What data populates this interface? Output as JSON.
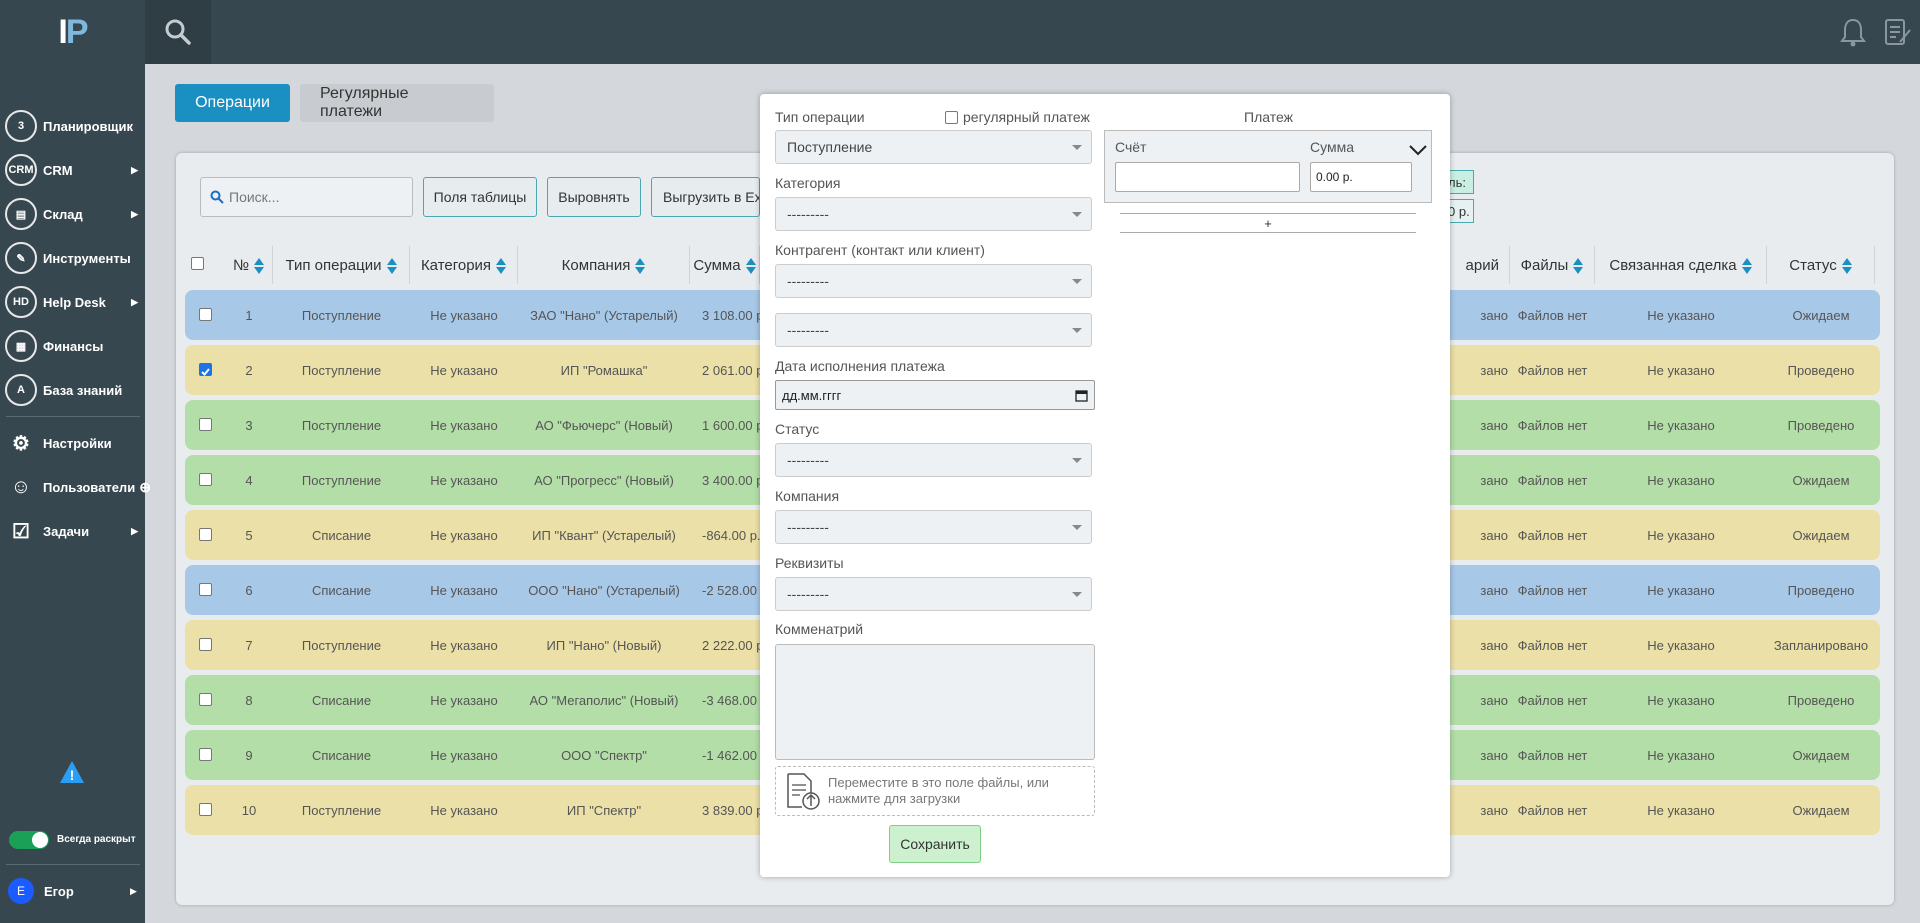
{
  "app": {
    "logo_a": "I",
    "logo_b": "P"
  },
  "sidebar": {
    "items": [
      {
        "label": "Планировщик",
        "icon": "calendar-icon",
        "glyph": "3",
        "arrow": false
      },
      {
        "label": "CRM",
        "icon": "crm-icon",
        "glyph": "CRM",
        "arrow": true
      },
      {
        "label": "Склад",
        "icon": "warehouse-icon",
        "glyph": "▤",
        "arrow": true
      },
      {
        "label": "Инструменты",
        "icon": "wrench-icon",
        "glyph": "✎",
        "arrow": false
      },
      {
        "label": "Help Desk",
        "icon": "helpdesk-icon",
        "glyph": "HD",
        "arrow": true
      },
      {
        "label": "Финансы",
        "icon": "finance-icon",
        "glyph": "▦",
        "arrow": false
      },
      {
        "label": "База знаний",
        "icon": "knowledge-icon",
        "glyph": "A",
        "arrow": false
      }
    ],
    "items2": [
      {
        "label": "Настройки",
        "icon": "gear-icon",
        "glyph": "⚙",
        "arrow": false
      },
      {
        "label": "Пользователи",
        "icon": "users-icon",
        "glyph": "☺",
        "arrow": false
      },
      {
        "label": "Задачи",
        "icon": "tasks-icon",
        "glyph": "☑",
        "arrow": true
      }
    ],
    "always_open_label": "Всегда раскрыт",
    "user_name": "Егор",
    "user_initial": "Е",
    "warning_glyph": "!"
  },
  "tabs": {
    "operations": "Операции",
    "regular": "Регулярные платежи"
  },
  "toolbar": {
    "search_placeholder": "Поиск...",
    "fields_label": "Поля таблицы",
    "align_label": "Выровнять",
    "export_label": "Выгрузить в Excel",
    "partial_top": "ль:",
    "partial_bottom": "0 р."
  },
  "table": {
    "headers": {
      "num": "№",
      "type": "Тип операции",
      "category": "Категория",
      "company": "Компания",
      "sum": "Сумма",
      "comment": "арий",
      "files": "Файлы",
      "deal": "Связанная сделка",
      "status": "Статус"
    },
    "rows": [
      {
        "num": "1",
        "type": "Поступление",
        "category": "Не указано",
        "company": "ЗАО \"Нано\" (Устарелый)",
        "sum": "3 108.00 р.",
        "comment": "зано",
        "files": "Файлов нет",
        "deal": "Не указано",
        "status": "Ожидаем",
        "color": "blue",
        "checked": false
      },
      {
        "num": "2",
        "type": "Поступление",
        "category": "Не указано",
        "company": "ИП \"Ромашка\"",
        "sum": "2 061.00 р.",
        "comment": "зано",
        "files": "Файлов нет",
        "deal": "Не указано",
        "status": "Проведено",
        "color": "yellow",
        "checked": true
      },
      {
        "num": "3",
        "type": "Поступление",
        "category": "Не указано",
        "company": "АО \"Фьючерс\" (Новый)",
        "sum": "1 600.00 р.",
        "comment": "зано",
        "files": "Файлов нет",
        "deal": "Не указано",
        "status": "Проведено",
        "color": "green",
        "checked": false
      },
      {
        "num": "4",
        "type": "Поступление",
        "category": "Не указано",
        "company": "АО \"Прогресс\" (Новый)",
        "sum": "3 400.00 р.",
        "comment": "зано",
        "files": "Файлов нет",
        "deal": "Не указано",
        "status": "Ожидаем",
        "color": "green",
        "checked": false
      },
      {
        "num": "5",
        "type": "Списание",
        "category": "Не указано",
        "company": "ИП \"Квант\" (Устарелый)",
        "sum": "-864.00 р.",
        "comment": "зано",
        "files": "Файлов нет",
        "deal": "Не указано",
        "status": "Ожидаем",
        "color": "yellow",
        "checked": false
      },
      {
        "num": "6",
        "type": "Списание",
        "category": "Не указано",
        "company": "ООО \"Нано\" (Устарелый)",
        "sum": "-2 528.00 р.",
        "comment": "зано",
        "files": "Файлов нет",
        "deal": "Не указано",
        "status": "Проведено",
        "color": "blue",
        "checked": false
      },
      {
        "num": "7",
        "type": "Поступление",
        "category": "Не указано",
        "company": "ИП \"Нано\" (Новый)",
        "sum": "2 222.00 р.",
        "comment": "зано",
        "files": "Файлов нет",
        "deal": "Не указано",
        "status": "Запланировано",
        "color": "yellow",
        "checked": false
      },
      {
        "num": "8",
        "type": "Списание",
        "category": "Не указано",
        "company": "АО \"Мегаполис\" (Новый)",
        "sum": "-3 468.00 р.",
        "comment": "зано",
        "files": "Файлов нет",
        "deal": "Не указано",
        "status": "Проведено",
        "color": "green",
        "checked": false
      },
      {
        "num": "9",
        "type": "Списание",
        "category": "Не указано",
        "company": "ООО \"Спектр\"",
        "sum": "-1 462.00 р.",
        "comment": "зано",
        "files": "Файлов нет",
        "deal": "Не указано",
        "status": "Ожидаем",
        "color": "green",
        "checked": false
      },
      {
        "num": "10",
        "type": "Поступление",
        "category": "Не указано",
        "company": "ИП \"Спектр\"",
        "sum": "3 839.00 р.",
        "comment": "зано",
        "files": "Файлов нет",
        "deal": "Не указано",
        "status": "Ожидаем",
        "color": "yellow",
        "checked": false
      }
    ]
  },
  "modal": {
    "op_type_label": "Тип операции",
    "regular_label": "регулярный платеж",
    "op_type_value": "Поступление",
    "category_label": "Категория",
    "category_value": "---------",
    "counterparty_label": "Контрагент (контакт или клиент)",
    "counterparty_value": "---------",
    "counterparty2_value": "---------",
    "date_label": "Дата исполнения платежа",
    "date_placeholder": "дд.мм.гггг",
    "status_label": "Статус",
    "status_value": "---------",
    "company_label": "Компания",
    "company_value": "---------",
    "requisites_label": "Реквизиты",
    "requisites_value": "---------",
    "comment_label": "Комменатрий",
    "dropzone_text": "Переместите в это поле файлы, или нажмите для загрузки",
    "save_label": "Сохранить",
    "payment": {
      "title": "Платеж",
      "account_label": "Счёт",
      "sum_label": "Сумма",
      "sum_value": "0.00 р.",
      "add_label": "+"
    }
  },
  "colors": {
    "sidebar": "#37474f",
    "accent": "#1a8fc1",
    "row_blue": "#a8c8e8",
    "row_yellow": "#ebe0a8",
    "row_green": "#b4dea8"
  }
}
